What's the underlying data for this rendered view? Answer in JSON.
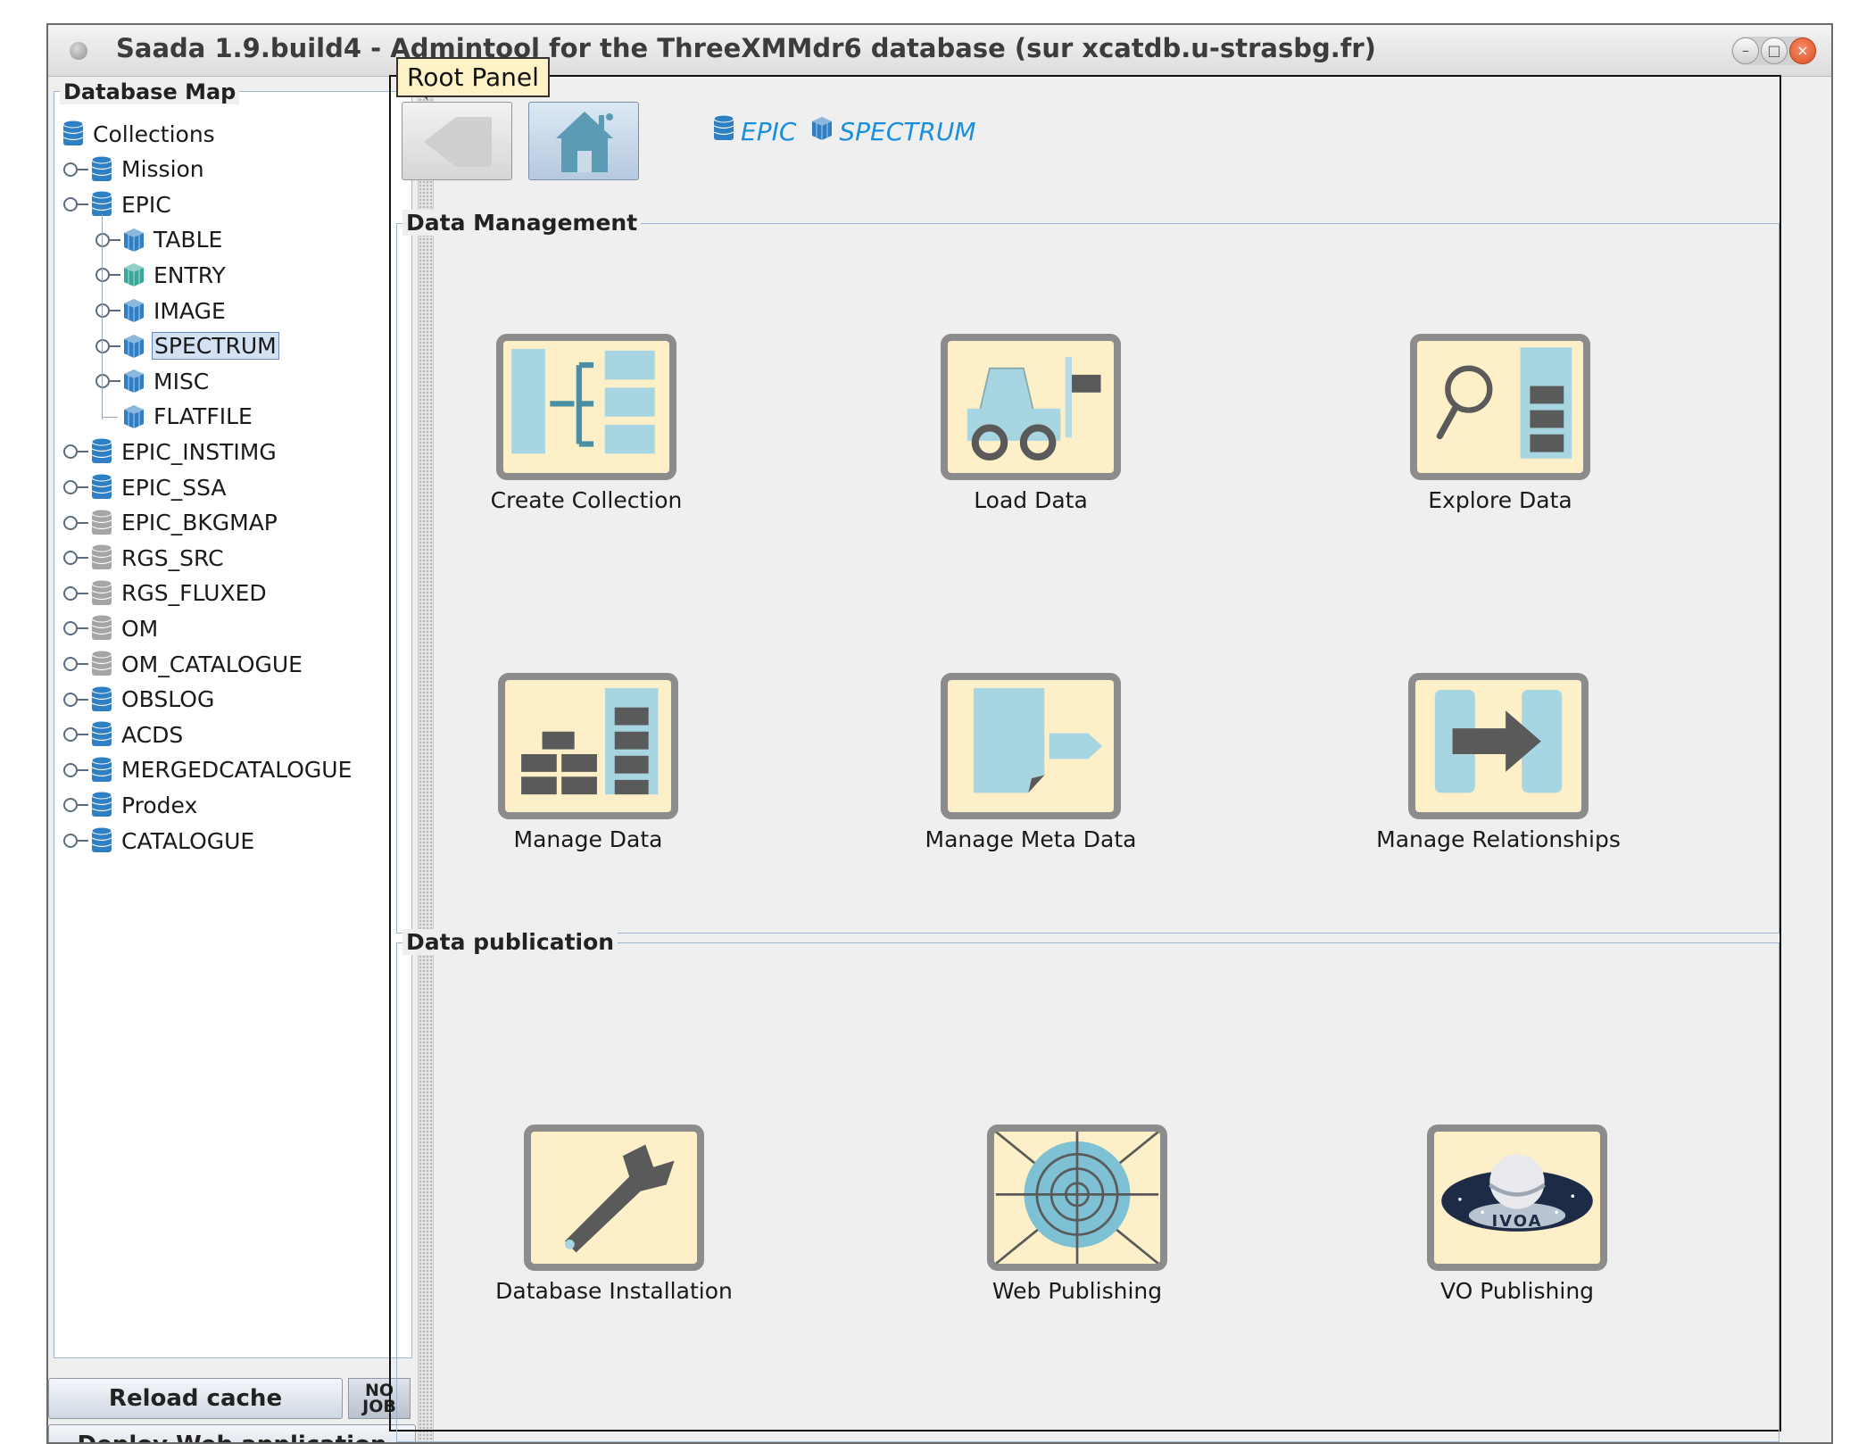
{
  "window": {
    "title": "Saada 1.9.build4 - Admintool for the ThreeXMMdr6 database (sur xcatdb.u-strasbg.fr)",
    "controls": {
      "minimize": "–",
      "maximize": "□",
      "close": "×"
    }
  },
  "left_panel": {
    "title": "Database Map",
    "tree": [
      {
        "label": "Collections",
        "icon": "database-icon",
        "color": "#2f7fc4"
      },
      {
        "label": "Mission",
        "icon": "database-icon",
        "color": "#2f7fc4"
      },
      {
        "label": "EPIC",
        "icon": "database-icon",
        "color": "#2f7fc4"
      },
      {
        "label": "TABLE",
        "icon": "cube-icon",
        "color": "#2f7fc4"
      },
      {
        "label": "ENTRY",
        "icon": "cube-icon",
        "color": "#39a89b"
      },
      {
        "label": "IMAGE",
        "icon": "cube-icon",
        "color": "#2f7fc4"
      },
      {
        "label": "SPECTRUM",
        "icon": "cube-icon",
        "color": "#2f7fc4",
        "selected": true
      },
      {
        "label": "MISC",
        "icon": "cube-icon",
        "color": "#2f7fc4"
      },
      {
        "label": "FLATFILE",
        "icon": "cube-icon",
        "color": "#2f7fc4"
      },
      {
        "label": "EPIC_INSTIMG",
        "icon": "database-icon",
        "color": "#2f7fc4"
      },
      {
        "label": "EPIC_SSA",
        "icon": "database-icon",
        "color": "#2f7fc4"
      },
      {
        "label": "EPIC_BKGMAP",
        "icon": "database-icon",
        "color": "#a5a5a5"
      },
      {
        "label": "RGS_SRC",
        "icon": "database-icon",
        "color": "#a5a5a5"
      },
      {
        "label": "RGS_FLUXED",
        "icon": "database-icon",
        "color": "#a5a5a5"
      },
      {
        "label": "OM",
        "icon": "database-icon",
        "color": "#a5a5a5"
      },
      {
        "label": "OM_CATALOGUE",
        "icon": "database-icon",
        "color": "#a5a5a5"
      },
      {
        "label": "OBSLOG",
        "icon": "database-icon",
        "color": "#2f7fc4"
      },
      {
        "label": "ACDS",
        "icon": "database-icon",
        "color": "#2f7fc4"
      },
      {
        "label": "MERGEDCATALOGUE",
        "icon": "database-icon",
        "color": "#2f7fc4"
      },
      {
        "label": "Prodex",
        "icon": "database-icon",
        "color": "#2f7fc4"
      },
      {
        "label": "CATALOGUE",
        "icon": "database-icon",
        "color": "#2f7fc4"
      }
    ],
    "reload_label": "Reload cache",
    "nojob_label": "NO\nJOB",
    "deploy_label": "Deploy Web application"
  },
  "main": {
    "panel_title": "Root Panel",
    "back_icon": "back-arrow-icon",
    "home_icon": "home-icon",
    "breadcrumb": [
      {
        "label": "EPIC",
        "icon": "database-icon"
      },
      {
        "label": "SPECTRUM",
        "icon": "cube-icon"
      }
    ],
    "data_management": {
      "title": "Data Management",
      "items": [
        {
          "label": "Create Collection",
          "icon": "create-collection-icon"
        },
        {
          "label": "Load Data",
          "icon": "forklift-icon"
        },
        {
          "label": "Explore Data",
          "icon": "magnifier-icon"
        },
        {
          "label": "Manage Data",
          "icon": "bricks-icon"
        },
        {
          "label": "Manage Meta Data",
          "icon": "document-tag-icon"
        },
        {
          "label": "Manage Relationships",
          "icon": "relationship-arrow-icon"
        }
      ]
    },
    "data_publication": {
      "title": "Data publication",
      "items": [
        {
          "label": "Database Installation",
          "icon": "wrench-icon"
        },
        {
          "label": "Web Publishing",
          "icon": "web-icon"
        },
        {
          "label": "VO Publishing",
          "icon": "ivoa-icon",
          "logo_text": "IVOA"
        }
      ]
    }
  },
  "colors": {
    "accent_blue": "#1a8fe0",
    "tile_bg": "#fdf0c9",
    "tile_border": "#8c8c8c",
    "tile_fill": "#a8d5e2",
    "tile_dark": "#5a5a5a"
  }
}
